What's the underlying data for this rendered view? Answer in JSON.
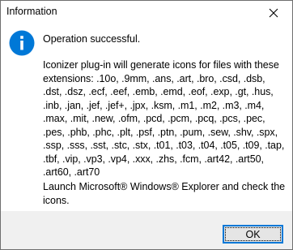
{
  "window": {
    "title": "Information",
    "close_icon": "close-icon"
  },
  "message": {
    "icon": "info-icon",
    "icon_color": "#0078d7",
    "heading": "Operation successful.",
    "body": "Iconizer plug-in will generate icons for files with these extensions: .10o, .9mm, .ans, .art, .bro, .csd, .dsb, .dst, .dsz, .ecf, .eef, .emb, .emd, .eof, .exp, .gt, .hus, .inb, .jan, .jef, .jef+, .jpx, .ksm, .m1, .m2, .m3, .m4, .max, .mit, .new, .ofm, .pcd, .pcm, .pcq, .pcs, .pec, .pes, .phb, .phc, .plt, .psf, .ptn, .pum, .sew, .shv, .spx, .ssp, .sss, .sst, .stc, .stx, .t01, .t03, .t04, .t05, .t09, .tap, .tbf, .vip, .vp3, .vp4, .xxx, .zhs, .fcm, .art42, .art50, .art60, .art70",
    "footer": "Launch Microsoft® Windows® Explorer and check the icons."
  },
  "buttons": {
    "ok_label": "OK"
  },
  "colors": {
    "accent": "#0078d7",
    "footer_bg": "#f0f0f0",
    "button_bg": "#e5e5e5"
  }
}
